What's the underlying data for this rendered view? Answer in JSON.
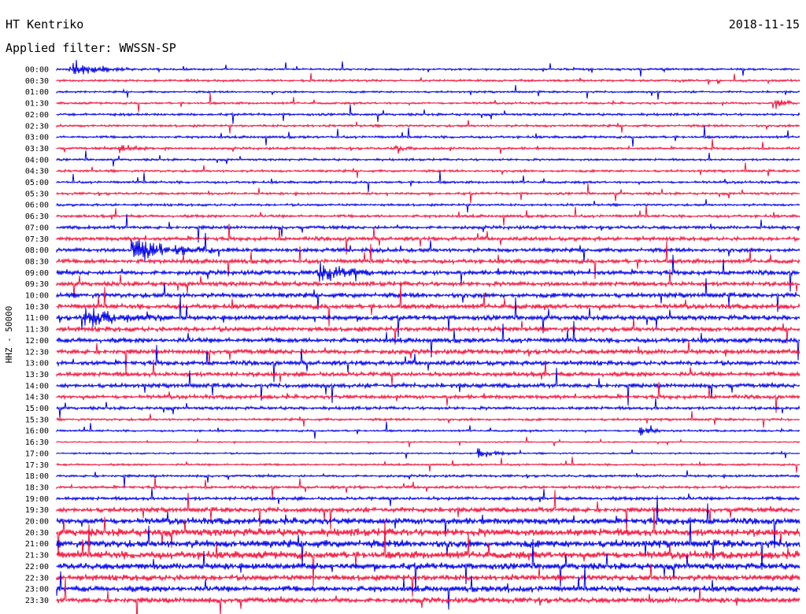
{
  "header": {
    "station": "HT Kentriko",
    "date": "2018-11-15",
    "filter_label": "Applied filter: WWSSN-SP"
  },
  "side_label": "HHZ - 50000",
  "colors": {
    "trace_a": "#0000e6",
    "trace_b": "#f0143c",
    "background": "#ffffff"
  },
  "chart_data": {
    "type": "line",
    "title": "HT Kentriko",
    "subtitle": "Applied filter: WWSSN-SP",
    "ylabel": "HHZ - 50000",
    "xlabel": "",
    "categories": [
      "00:00",
      "00:30",
      "01:00",
      "01:30",
      "02:00",
      "02:30",
      "03:00",
      "03:30",
      "04:00",
      "04:30",
      "05:00",
      "05:30",
      "06:00",
      "06:30",
      "07:00",
      "07:30",
      "08:00",
      "08:30",
      "09:00",
      "09:30",
      "10:00",
      "10:30",
      "11:00",
      "11:30",
      "12:00",
      "12:30",
      "13:00",
      "13:30",
      "14:00",
      "14:30",
      "15:00",
      "15:30",
      "16:00",
      "16:30",
      "17:00",
      "17:30",
      "18:00",
      "18:30",
      "19:00",
      "19:30",
      "20:00",
      "20:30",
      "21:00",
      "21:30",
      "22:00",
      "22:30",
      "23:00",
      "23:30"
    ],
    "trace_colors": [
      "#0000e6",
      "#f0143c"
    ],
    "minutes_per_line": 30,
    "noise_level": [
      0.18,
      0.2,
      0.18,
      0.2,
      0.22,
      0.22,
      0.22,
      0.22,
      0.2,
      0.22,
      0.22,
      0.22,
      0.22,
      0.25,
      0.3,
      0.35,
      0.38,
      0.4,
      0.42,
      0.42,
      0.45,
      0.45,
      0.45,
      0.45,
      0.45,
      0.45,
      0.42,
      0.42,
      0.4,
      0.35,
      0.28,
      0.22,
      0.18,
      0.12,
      0.15,
      0.18,
      0.22,
      0.25,
      0.3,
      0.45,
      0.6,
      0.7,
      0.7,
      0.7,
      0.6,
      0.55,
      0.55,
      0.5
    ],
    "events": [
      {
        "line": "00:00",
        "minute": 0.5,
        "duration_min": 3,
        "amplitude": 1.6
      },
      {
        "line": "01:30",
        "minute": 29,
        "duration_min": 1.2,
        "amplitude": 1.0
      },
      {
        "line": "03:30",
        "minute": 2.5,
        "duration_min": 1.5,
        "amplitude": 0.8
      },
      {
        "line": "03:30",
        "minute": 13.5,
        "duration_min": 1.2,
        "amplitude": 0.7
      },
      {
        "line": "08:00",
        "minute": 3.0,
        "duration_min": 4,
        "amplitude": 2.6
      },
      {
        "line": "09:00",
        "minute": 10.5,
        "duration_min": 3,
        "amplitude": 1.8
      },
      {
        "line": "11:00",
        "minute": 1.0,
        "duration_min": 4,
        "amplitude": 2.0
      },
      {
        "line": "16:00",
        "minute": 23.5,
        "duration_min": 1.0,
        "amplitude": 1.0
      },
      {
        "line": "17:00",
        "minute": 17.0,
        "duration_min": 1.5,
        "amplitude": 1.1
      },
      {
        "line": "23:00",
        "minute": 18.0,
        "duration_min": 0.8,
        "amplitude": 1.0
      }
    ]
  }
}
